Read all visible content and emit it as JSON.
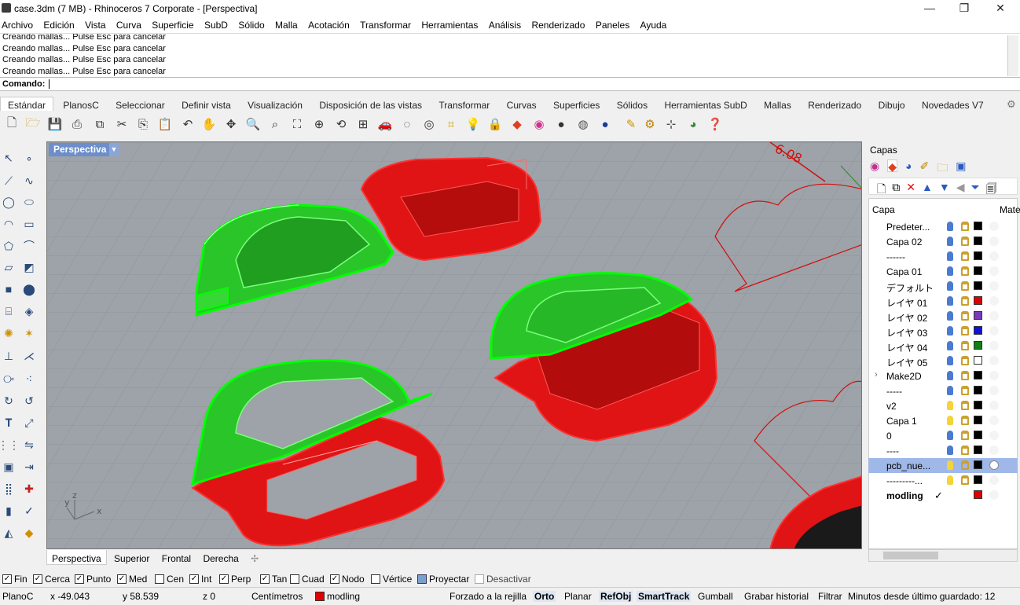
{
  "window": {
    "title": "case.3dm (7 MB) - Rhinoceros 7 Corporate - [Perspectiva]",
    "minimize": "—",
    "maximize": "❐",
    "close": "✕"
  },
  "menu": [
    "Archivo",
    "Edición",
    "Vista",
    "Curva",
    "Superficie",
    "SubD",
    "Sólido",
    "Malla",
    "Acotación",
    "Transformar",
    "Herramientas",
    "Análisis",
    "Renderizado",
    "Paneles",
    "Ayuda"
  ],
  "history": [
    "Creando mallas... Pulse Esc para cancelar",
    "Creando mallas... Pulse Esc para cancelar",
    "Creando mallas... Pulse Esc para cancelar",
    "Creando mallas... Pulse Esc para cancelar"
  ],
  "command": {
    "label": "Comando:",
    "value": ""
  },
  "tabs": [
    "Estándar",
    "PlanosC",
    "Seleccionar",
    "Definir vista",
    "Visualización",
    "Disposición de las vistas",
    "Transformar",
    "Curvas",
    "Superficies",
    "Sólidos",
    "Herramientas SubD",
    "Mallas",
    "Renderizado",
    "Dibujo",
    "Novedades V7"
  ],
  "toolbar_icons": [
    "new-icon",
    "open-icon",
    "save-icon",
    "print-icon",
    "import-icon",
    "cut-icon",
    "copy-icon",
    "paste-icon",
    "undo-icon",
    "pan-icon",
    "rotate-icon",
    "zoom-icon",
    "zoom-window-icon",
    "zoom-extents-icon",
    "zoom-selected-icon",
    "rotate-view-icon",
    "four-viewports-icon",
    "car-icon",
    "ghosted-icon",
    "xray-icon",
    "snap-icon",
    "light-icon",
    "lock-icon",
    "layer-icon",
    "color-wheel-icon",
    "material-icon",
    "sphere-icon",
    "render-icon",
    "shade-icon",
    "options-icon",
    "gear-icon",
    "grid-icon",
    "globe-icon",
    "help-icon"
  ],
  "viewport": {
    "label": "Perspectiva",
    "axis_x": "x",
    "axis_y": "y",
    "axis_z": "z",
    "dimension_text": "6.08"
  },
  "viewtabs": [
    "Perspectiva",
    "Superior",
    "Frontal",
    "Derecha"
  ],
  "osnaps": [
    {
      "label": "Fin",
      "checked": true
    },
    {
      "label": "Cerca",
      "checked": true
    },
    {
      "label": "Punto",
      "checked": true
    },
    {
      "label": "Med",
      "checked": true
    },
    {
      "label": "Cen",
      "checked": false
    },
    {
      "label": "Int",
      "checked": true
    },
    {
      "label": "Perp",
      "checked": true
    },
    {
      "label": "Tan",
      "checked": true
    },
    {
      "label": "Cuad",
      "checked": false
    },
    {
      "label": "Nodo",
      "checked": true
    },
    {
      "label": "Vértice",
      "checked": false
    },
    {
      "label": "Proyectar",
      "checked": true
    },
    {
      "label": "Desactivar",
      "checked": false
    }
  ],
  "status": {
    "cplane": "PlanoC",
    "x": "x -49.043",
    "y": "y 58.539",
    "z": "z 0",
    "units": "Centímetros",
    "layer": "modling",
    "grid_snap": "Forzado a la rejilla",
    "ortho": "Orto",
    "planar": "Planar",
    "osnap": "RefObj",
    "smarttrack": "SmartTrack",
    "gumball": "Gumball",
    "history": "Grabar historial",
    "filter": "Filtrar",
    "autosave": "Minutos desde último guardado: 12",
    "layer_color": "#e00000"
  },
  "layers_panel": {
    "title": "Capas",
    "col_layer": "Capa",
    "col_material": "Materi",
    "rows": [
      {
        "name": "Predeter...",
        "color": "#000000",
        "bulb": "blue"
      },
      {
        "name": "Capa 02",
        "color": "#000000",
        "bulb": "blue"
      },
      {
        "name": "------",
        "color": "#000000",
        "bulb": "blue"
      },
      {
        "name": "Capa 01",
        "color": "#000000",
        "bulb": "blue"
      },
      {
        "name": "デフォルト",
        "color": "#000000",
        "bulb": "blue"
      },
      {
        "name": "レイヤ 01",
        "color": "#e00000",
        "bulb": "blue"
      },
      {
        "name": "レイヤ 02",
        "color": "#7a3ab8",
        "bulb": "blue"
      },
      {
        "name": "レイヤ 03",
        "color": "#1010e0",
        "bulb": "blue"
      },
      {
        "name": "レイヤ 04",
        "color": "#108010",
        "bulb": "blue"
      },
      {
        "name": "レイヤ 05",
        "color": "#ffffff",
        "bulb": "blue"
      },
      {
        "name": "Make2D",
        "color": "#000000",
        "bulb": "blue"
      },
      {
        "name": "-----",
        "color": "#000000",
        "bulb": "blue"
      },
      {
        "name": "v2",
        "color": "#000000",
        "bulb": "yellow"
      },
      {
        "name": "Capa 1",
        "color": "#000000",
        "bulb": "yellow"
      },
      {
        "name": "0",
        "color": "#000000",
        "bulb": "blue"
      },
      {
        "name": "----",
        "color": "#000000",
        "bulb": "blue"
      },
      {
        "name": "pcb_nue...",
        "color": "#000000",
        "bulb": "yellow"
      },
      {
        "name": "---------...",
        "color": "#000000",
        "bulb": "yellow"
      },
      {
        "name": "modling",
        "color": "#e00000",
        "bulb": "none"
      }
    ],
    "current_mark": "✓"
  }
}
